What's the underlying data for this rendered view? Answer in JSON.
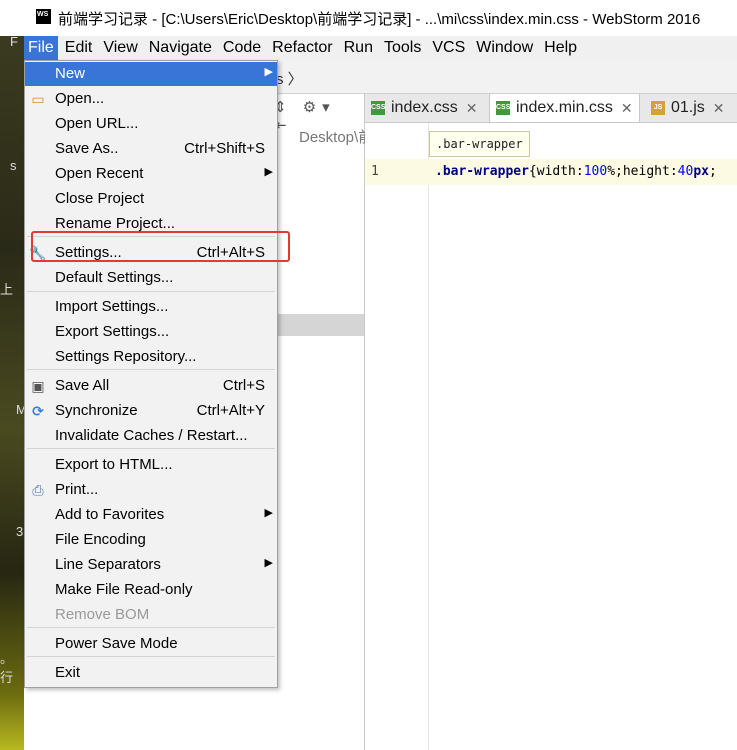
{
  "window": {
    "logo_text": "WS",
    "title": "前端学习记录 - [C:\\Users\\Eric\\Desktop\\前端学习记录] - ...\\mi\\css\\index.min.css - WebStorm 2016"
  },
  "menubar": [
    "File",
    "Edit",
    "View",
    "Navigate",
    "Code",
    "Refactor",
    "Run",
    "Tools",
    "VCS",
    "Window",
    "Help"
  ],
  "navbar": {
    "crumb": "s 〉"
  },
  "project": {
    "toolbar": "⇕ ⚙▾ ⇤",
    "path": "Desktop\\前端"
  },
  "tabs": [
    {
      "label": "index.css",
      "icon": "css",
      "close": "✕"
    },
    {
      "label": "index.min.css",
      "icon": "css",
      "close": "✕",
      "active": true
    },
    {
      "label": "01.js",
      "icon": "js",
      "close": "✕"
    }
  ],
  "editor": {
    "line_number": "1",
    "breadcrumb_tip": ".bar-wrapper",
    "selector": ".bar-wrapper",
    "brace": "{",
    "prop1": "width:",
    "val1": "100",
    "unit1": "%;",
    "prop2": "height:",
    "val2": "40",
    "unit2": "px",
    "tail": ";"
  },
  "desktop_fragments": [
    "F",
    "s",
    "上",
    "M",
    "3",
    "。 行"
  ],
  "file_menu": {
    "items": [
      {
        "label": "New",
        "submenu": true,
        "highlighted": true
      },
      {
        "label": "Open...",
        "icon": "folder-icon"
      },
      {
        "label": "Open URL..."
      },
      {
        "label": "Save As..",
        "shortcut": "Ctrl+Shift+S"
      },
      {
        "label": "Open Recent",
        "submenu": true
      },
      {
        "label": "Close Project"
      },
      {
        "label": "Rename Project..."
      },
      {
        "label": "Settings...",
        "shortcut": "Ctrl+Alt+S",
        "icon": "wrench-icon"
      },
      {
        "label": "Default Settings..."
      },
      {
        "label": "Import Settings..."
      },
      {
        "label": "Export Settings..."
      },
      {
        "label": "Settings Repository..."
      },
      {
        "label": "Save All",
        "shortcut": "Ctrl+S",
        "icon": "save-icon"
      },
      {
        "label": "Synchronize",
        "shortcut": "Ctrl+Alt+Y",
        "icon": "sync-icon"
      },
      {
        "label": "Invalidate Caches / Restart..."
      },
      {
        "label": "Export to HTML..."
      },
      {
        "label": "Print...",
        "icon": "printer-icon"
      },
      {
        "label": "Add to Favorites",
        "submenu": true
      },
      {
        "label": "File Encoding"
      },
      {
        "label": "Line Separators",
        "submenu": true
      },
      {
        "label": "Make File Read-only"
      },
      {
        "label": "Remove BOM",
        "disabled": true
      },
      {
        "label": "Power Save Mode"
      },
      {
        "label": "Exit"
      }
    ]
  },
  "colors": {
    "menu_highlight": "#3875d7",
    "annotation_box": "#e53935",
    "current_line": "#fcfae3"
  }
}
